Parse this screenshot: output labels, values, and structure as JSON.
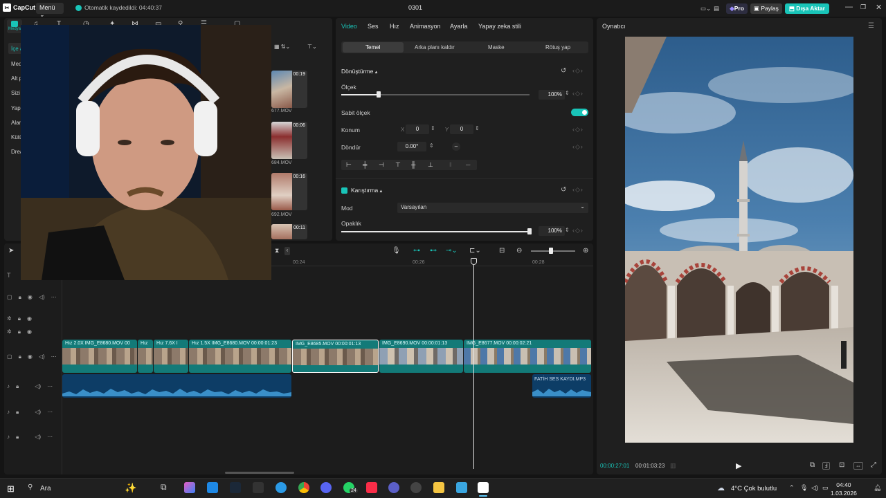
{
  "titlebar": {
    "app_name": "CapCut",
    "menu_label": "Menü",
    "autosave_text": "Otomatik kaydedildi: 04:40:37",
    "project_title": "0301",
    "pro_label": "Pro",
    "share_label": "Paylaş",
    "export_label": "Dışa Aktar"
  },
  "left_panel": {
    "media_tab_label": "Medya",
    "side_items": [
      "İçe a",
      "Med",
      "Alt p",
      "Sizi",
      "Yap",
      "Alar",
      "Kütü",
      "Drea"
    ],
    "media_items": [
      {
        "duration": "00:19",
        "name": "677.MOV"
      },
      {
        "duration": "00:06",
        "name": "684.MOV"
      },
      {
        "duration": "00:16",
        "name": "692.MOV"
      },
      {
        "duration": "00:11",
        "name": ""
      }
    ]
  },
  "properties": {
    "tabs": [
      "Video",
      "Ses",
      "Hız",
      "Animasyon",
      "Ayarla",
      "Yapay zeka stili"
    ],
    "active_tab": "Video",
    "subtabs": [
      "Temel",
      "Arka planı kaldır",
      "Maske",
      "Rötuş yap"
    ],
    "transform_title": "Dönüştürme",
    "scale_label": "Ölçek",
    "scale_value": "100%",
    "scale_fraction": 0.2,
    "uniform_scale_label": "Sabit ölçek",
    "position_label": "Konum",
    "pos_x_label": "X",
    "pos_x": "0",
    "pos_y_label": "Y",
    "pos_y": "0",
    "rotate_label": "Döndür",
    "rotate_value": "0.00°",
    "blend_title": "Karıştırma",
    "mode_label": "Mod",
    "mode_value": "Varsayılan",
    "opacity_label": "Opaklık",
    "opacity_value": "100%",
    "opacity_fraction": 1.0
  },
  "player": {
    "title": "Oynatıcı",
    "current_time": "00:00:27:01",
    "total_time": "00:01:03:23"
  },
  "timeline": {
    "ruler": [
      "00:24",
      "00:26",
      "00:28"
    ],
    "clips": [
      {
        "label": "Hız 2.0X  IMG_E8680.MOV  00"
      },
      {
        "label": "Hız"
      },
      {
        "label": "Hız 7.6X  I"
      },
      {
        "label": "Hız 1.5X  IMG_E8680.MOV  00:00:01:23"
      },
      {
        "label": "IMG_E8685.MOV  00:00:01:13"
      },
      {
        "label": "IMG_E8690.MOV  00:00:01:13"
      },
      {
        "label": "IMG_E8677.MOV  00:00:02:21"
      }
    ],
    "audio_label": "FATİH SES KAYDI.MP3"
  },
  "taskbar": {
    "search_label": "Ara",
    "weather": "4°C  Çok bulutlu",
    "time": "04:40",
    "date": "1.03.2026",
    "badge": "24"
  },
  "colors": {
    "accent": "#19c4b8",
    "clip": "#137a78",
    "audio": "#0d3d66"
  }
}
